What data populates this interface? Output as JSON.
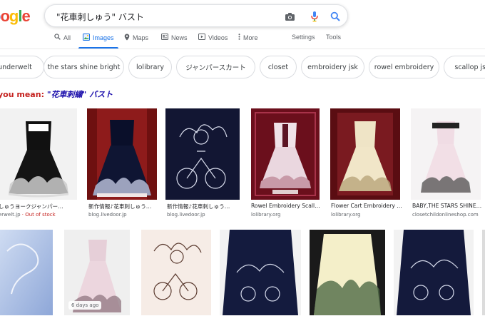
{
  "logo": {
    "g": "o",
    "o1": "o",
    "o2": "g",
    "l": "l",
    "e": "e"
  },
  "search": {
    "query": "\"花車刺しゅう\" バスト"
  },
  "tabs": [
    {
      "label": "All",
      "icon": "search-icon"
    },
    {
      "label": "Images",
      "icon": "image-icon"
    },
    {
      "label": "Maps",
      "icon": "map-pin-icon"
    },
    {
      "label": "News",
      "icon": "news-icon"
    },
    {
      "label": "Videos",
      "icon": "video-icon"
    },
    {
      "label": "More",
      "icon": "more-vert-icon"
    },
    {
      "label": "Settings"
    },
    {
      "label": "Tools"
    }
  ],
  "chips": [
    "underwelt",
    "the stars shine bright",
    "lolibrary",
    "ジャンパースカート",
    "closet",
    "embroidery jsk",
    "rowel embroidery",
    "scallop jsk"
  ],
  "did_you_mean": {
    "prefix": "you mean:",
    "suggestion": "\"花車刺繍\" バスト"
  },
  "results_row1": [
    {
      "title": "しゅうヨークジャンパー…",
      "source": "erwelt.jp",
      "extra": " · Out of stock"
    },
    {
      "title": "新作情報♪花車刺しゅう…",
      "source": "blog.livedoor.jp"
    },
    {
      "title": "新作情報♪花車刺しゅう…",
      "source": "blog.livedoor.jp"
    },
    {
      "title": "Rowel Embroidery Scall…",
      "source": "lolibrary.org"
    },
    {
      "title": "Flower Cart Embroidery …",
      "source": "lolibrary.org"
    },
    {
      "title": "BABY,THE STARS SHINE…",
      "source": "closetchildonlineshop.com"
    }
  ],
  "results_row2_badge": "6 days ago",
  "colors": {
    "accent": "#1a73e8",
    "link": "#1a0dab",
    "alert": "#c5221f"
  }
}
